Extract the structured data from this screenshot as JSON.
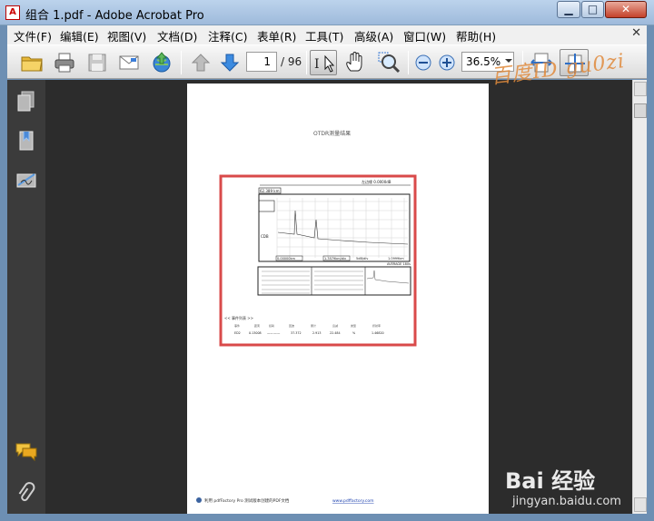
{
  "window": {
    "title": "组合 1.pdf - Adobe Acrobat Pro",
    "app_icon_label": "A",
    "minimize": "▁",
    "maximize": "□",
    "close": "✕"
  },
  "menu": {
    "items": [
      "文件(F)",
      "编辑(E)",
      "视图(V)",
      "文档(D)",
      "注释(C)",
      "表单(R)",
      "工具(T)",
      "高级(A)",
      "窗口(W)",
      "帮助(H)"
    ],
    "doc_close": "✕"
  },
  "toolbar": {
    "current_page": "1",
    "total_pages": "/ 96",
    "zoom": "36.5%",
    "select_tool_label": "I"
  },
  "page": {
    "header": "OTDR测量结果",
    "table_title": "<< 事件列表 >>",
    "footer_prefix": "利用 pdfFactory Pro 测试版本创建的PDF文档",
    "footer_link": "www.pdffactory.com",
    "report": {
      "top_right": "左边缘 0.0000dB",
      "dist_label": "62.389 km",
      "range_label": "1.3579km/div",
      "db_label": "5dB/div",
      "dist_right": "1.0999km",
      "avg_label": "AVERAGE 180s",
      "start_label": "0.00000km",
      "ylabel": "CDB",
      "event_row": [
        "ED2",
        "0.13008",
        "——.——",
        "37.372",
        "2.913",
        "22.484",
        "%",
        "1.46820"
      ]
    }
  },
  "watermark": {
    "top_text": "百度ID gu0zi",
    "brand": "Bai 经验",
    "url": "jingyan.baidu.com"
  }
}
